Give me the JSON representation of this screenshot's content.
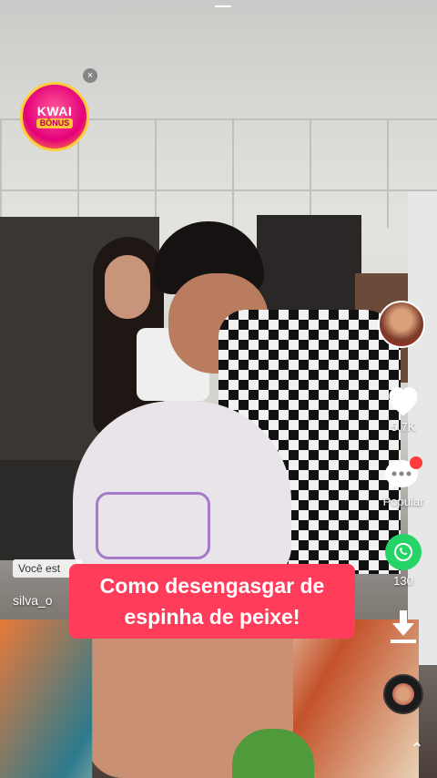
{
  "bonus": {
    "line1": "KWAI",
    "line2": "BÔNUS",
    "close": "×"
  },
  "sidebar": {
    "likes": "5.7K",
    "comments_label": "Popular",
    "shares": "130"
  },
  "video": {
    "context_label": "Você est",
    "username": "silva_o",
    "caption": "Como desengasgar de espinha de peixe!"
  },
  "nav": {
    "scroll_up": "⌃"
  },
  "colors": {
    "caption_bg": "#ff3d5a",
    "whatsapp": "#25d366",
    "notification_dot": "#ff3b3b"
  }
}
